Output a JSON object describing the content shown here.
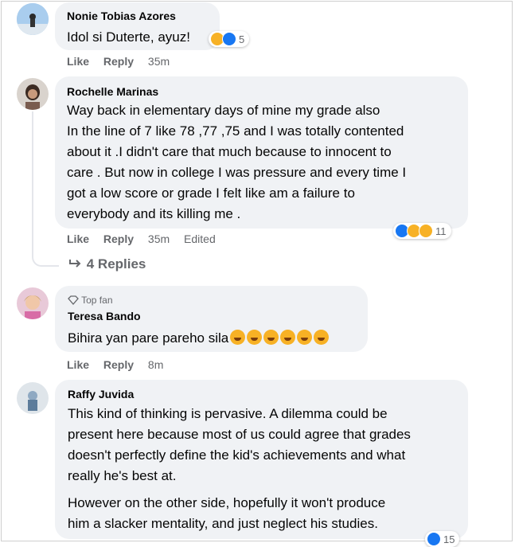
{
  "comments": [
    {
      "author": "Nonie Tobias Azores",
      "lines": [
        "Idol si Duterte, ayuz!"
      ],
      "reaction_count": "5",
      "actions": {
        "like": "Like",
        "reply": "Reply",
        "time": "35m"
      }
    },
    {
      "author": "Rochelle Marinas",
      "lines": [
        "Way back in elementary days of mine my grade also",
        "In the line of 7 like 78 ,77 ,75 and I was totally contented",
        "about it .I didn't care that much because to innocent to",
        "care . But now in college I was pressure and every time I",
        "got a low score or grade I felt like am a failure to",
        "everybody and its killing me ."
      ],
      "reaction_count": "11",
      "actions": {
        "like": "Like",
        "reply": "Reply",
        "time": "35m",
        "edited": "Edited"
      },
      "replies_label": "4 Replies"
    },
    {
      "badge": "Top fan",
      "author": "Teresa Bando",
      "lines": [
        "Bihira yan pare pareho sila"
      ],
      "actions": {
        "like": "Like",
        "reply": "Reply",
        "time": "8m"
      }
    },
    {
      "author": "Raffy Juvida",
      "paragraph1": [
        "This kind of thinking is pervasive. A dilemma could be",
        "present here because most of us could agree that grades",
        "doesn't perfectly define the kid's achievements and what",
        "really he's best at."
      ],
      "paragraph2": [
        "However on the other side, hopefully it won't produce",
        "him a slacker mentality, and just neglect his studies."
      ],
      "reaction_count": "15"
    }
  ],
  "colors": {
    "bubble": "#f0f2f5",
    "secondary_text": "#65676b",
    "like_blue": "#1877f2",
    "emoji_yellow": "#f7b125"
  }
}
